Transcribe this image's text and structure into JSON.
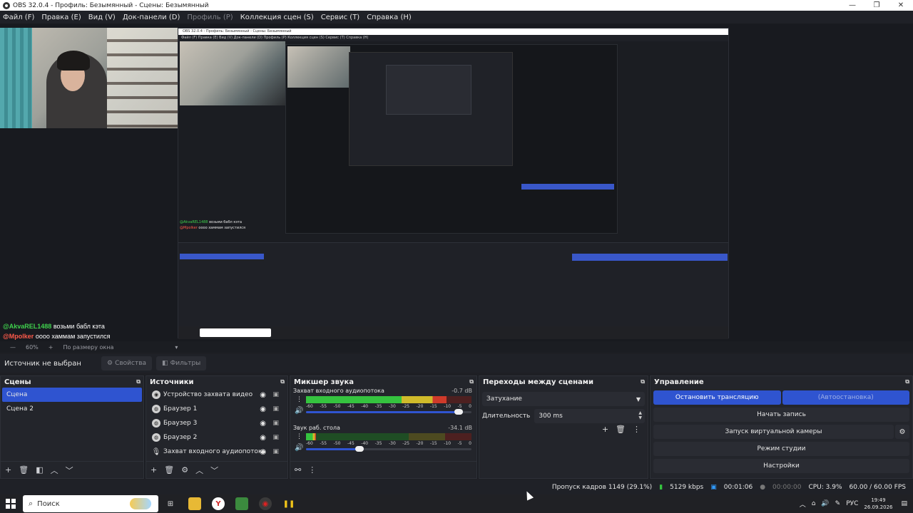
{
  "window": {
    "title": "OBS 32.0.4 - Профиль: Безымянный - Сцены: Безымянный",
    "controls": [
      "—",
      "❐",
      "✕"
    ]
  },
  "menu": [
    {
      "label": "Файл (F)",
      "disabled": false
    },
    {
      "label": "Правка (E)",
      "disabled": false
    },
    {
      "label": "Вид (V)",
      "disabled": false
    },
    {
      "label": "Док-панели (D)",
      "disabled": false
    },
    {
      "label": "Профиль (P)",
      "disabled": true
    },
    {
      "label": "Коллекция сцен (S)",
      "disabled": false
    },
    {
      "label": "Сервис (T)",
      "disabled": false
    },
    {
      "label": "Справка (H)",
      "disabled": false
    }
  ],
  "preview": {
    "nested_title": "OBS 32.0.4 - Профиль: Безымянный - Сцены: Безымянный",
    "nested_menu": "Файл (F)   Правка (E)   Вид (V)   Док-панели (D)   Профиль (P)   Коллекция сцен (S)   Сервис (T)   Справка (H)",
    "nested_chat": [
      {
        "user": "@AkvaREL1488",
        "text": "возьми бабл кэта"
      },
      {
        "user": "@Mpolker",
        "text": "оооо хаммам запустился"
      }
    ]
  },
  "chat": [
    {
      "user": "@AkvaREL1488",
      "text": "возьми бабл кэта"
    },
    {
      "user": "@Mpolker",
      "text": "оооо хаммам запустился"
    }
  ],
  "zoom": {
    "minus": "—",
    "level": "60%",
    "plus": "+",
    "fit": "По размеру окна"
  },
  "context": {
    "no_source": "Источник не выбран",
    "properties": "Свойства",
    "filters": "Фильтры"
  },
  "scenes": {
    "title": "Сцены",
    "items": [
      "Сцена",
      "Сцена 2"
    ],
    "active_index": 0
  },
  "sources": {
    "title": "Источники",
    "items": [
      {
        "label": "Устройство захвата видео",
        "icon": "camera-icon"
      },
      {
        "label": "Браузер 1",
        "icon": "globe-icon"
      },
      {
        "label": "Браузер 3",
        "icon": "globe-icon"
      },
      {
        "label": "Браузер 2",
        "icon": "globe-icon"
      },
      {
        "label": "Захват входного аудиопотока",
        "icon": "microphone-icon"
      }
    ]
  },
  "mixer": {
    "title": "Микшер звука",
    "channels": [
      {
        "name": "Захват входного аудиопотока",
        "db": "-0.7 dB",
        "level": 0.85,
        "volume": 0.95
      },
      {
        "name": "Звук раб. стола",
        "db": "-34.1 dB",
        "level": 0.06,
        "volume": 0.35
      }
    ],
    "scale": [
      "-60",
      "-55",
      "-50",
      "-45",
      "-40",
      "-35",
      "-30",
      "-25",
      "-20",
      "-15",
      "-10",
      "-5",
      "0"
    ]
  },
  "transitions": {
    "title": "Переходы между сценами",
    "selected": "Затухание",
    "duration_label": "Длительность",
    "duration_value": "300 ms"
  },
  "controls": {
    "title": "Управление",
    "stop_stream": "Остановить трансляцию",
    "auto_stop": "(Автоостановка)",
    "start_record": "Начать запись",
    "virtual_cam": "Запуск виртуальной камеры",
    "studio_mode": "Режим студии",
    "settings": "Настройки"
  },
  "status": {
    "dropped": "Пропуск кадров 1149 (29.1%)",
    "bitrate": "5129 kbps",
    "stream_time": "00:01:06",
    "rec_time": "00:00:00",
    "cpu": "CPU: 3.9%",
    "fps": "60.00 / 60.00 FPS"
  },
  "taskbar": {
    "search_placeholder": "Поиск",
    "lang": "РУС",
    "time": "19:49",
    "date": "26.09.2026"
  },
  "colors": {
    "accent": "#2f54d0",
    "bg": "#1e1f24",
    "panel": "#23252b",
    "meter_green": "#35c33f",
    "meter_yellow": "#d0bb2a",
    "meter_red": "#cf3a2a",
    "chat_user1": "#3fd14d",
    "chat_user2": "#ff5a4a"
  }
}
